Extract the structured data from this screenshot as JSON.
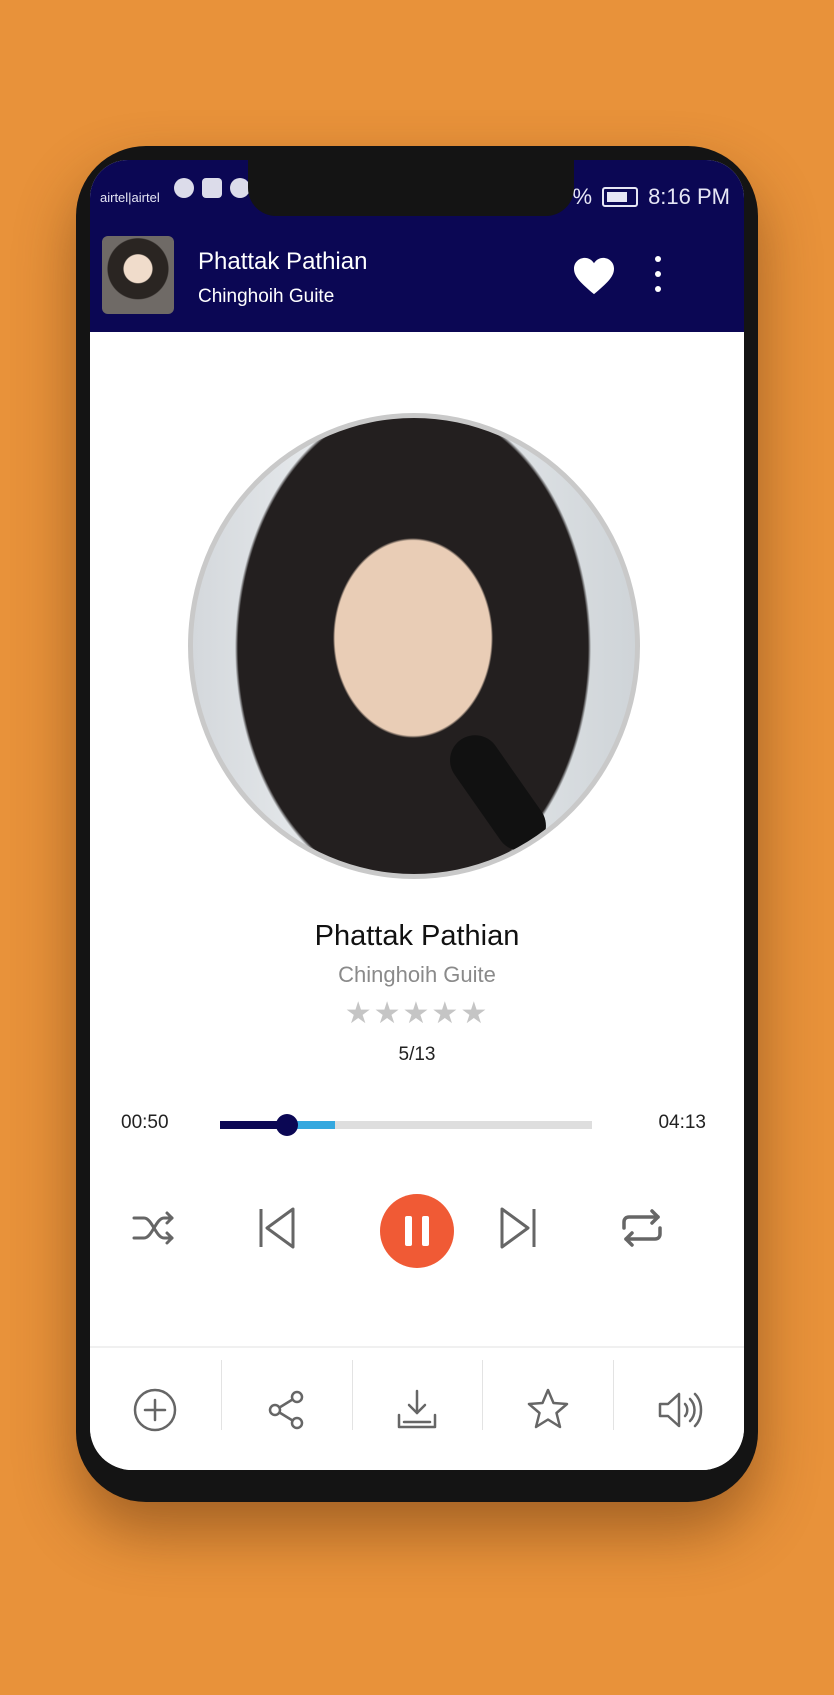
{
  "status_bar": {
    "carrier": "airtel|airtel",
    "time": "8:16 PM",
    "battery_text": "%"
  },
  "app_bar": {
    "title": "Phattak Pathian",
    "artist": "Chinghoih Guite"
  },
  "now_playing": {
    "title": "Phattak Pathian",
    "artist": "Chinghoih Guite",
    "stars": "★★★★★",
    "rating_out_of_5": 0,
    "track_counter": "5/13"
  },
  "progress": {
    "current_time": "00:50",
    "duration": "04:13",
    "played_fraction": 0.18,
    "buffered_fraction": 0.31
  },
  "controls": [
    "shuffle-icon",
    "previous-icon",
    "pause-icon",
    "next-icon",
    "repeat-icon"
  ],
  "bottom_actions": [
    "add-playlist-icon",
    "share-icon",
    "download-icon",
    "star-icon",
    "volume-icon"
  ],
  "colors": {
    "header": "#0b0754",
    "play_button": "#f05a35",
    "buffer": "#34a8df",
    "background": "#E8923A"
  }
}
